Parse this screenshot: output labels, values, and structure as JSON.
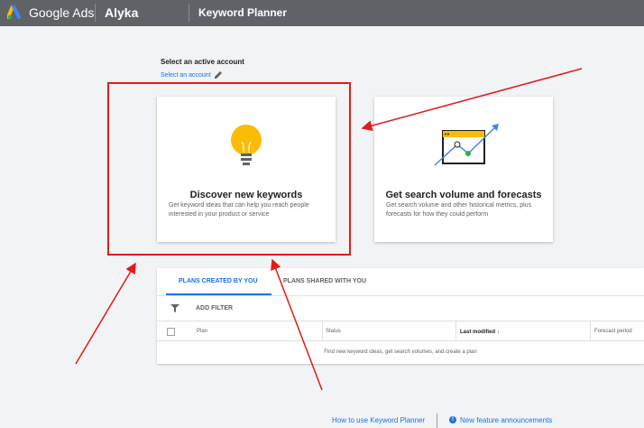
{
  "header": {
    "brand": "Google Ads",
    "account": "Alyka",
    "tool": "Keyword Planner",
    "background": "#5f6368"
  },
  "account_select": {
    "title": "Select an active account",
    "link": "Select an account",
    "icon": "pencil-icon"
  },
  "cards": [
    {
      "title": "Discover new keywords",
      "description": "Get keyword ideas that can help you reach people interested in your product or service",
      "icon": "lightbulb-icon",
      "highlighted": true
    },
    {
      "title": "Get search volume and forecasts",
      "description": "Get search volume and other historical metrics, plus forecasts for how they could perform",
      "icon": "trend-chart-icon"
    }
  ],
  "plans": {
    "tabs": [
      "PLANS CREATED BY YOU",
      "PLANS SHARED WITH YOU"
    ],
    "active_tab": 0,
    "filter_label": "ADD FILTER",
    "columns": [
      "Plan",
      "Status",
      "Last modified",
      "Forecast period"
    ],
    "empty_message": "Find new keyword ideas, get search volumes, and create a plan"
  },
  "footer": {
    "links": [
      "How to use Keyword Planner",
      "New feature announcements"
    ]
  },
  "colors": {
    "accent": "#1a73e8",
    "annotation": "#e31b1b",
    "bulb": "#fbbc04"
  }
}
